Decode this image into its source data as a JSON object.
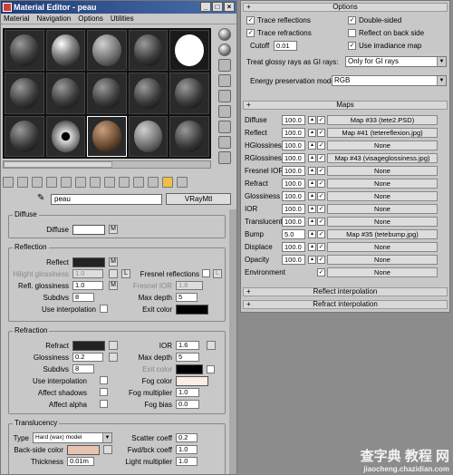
{
  "window": {
    "title": "Material Editor - peau",
    "buttons": [
      "_",
      "□",
      "×"
    ]
  },
  "menu": [
    "Material",
    "Navigation",
    "Options",
    "Utilities"
  ],
  "material": {
    "name": "peau",
    "type": "VRayMtl"
  },
  "diffuse": {
    "title": "Diffuse",
    "label": "Diffuse",
    "m": "M"
  },
  "reflection": {
    "title": "Reflection",
    "reflect": "Reflect",
    "m": "M",
    "hilight_label": "Hilight glossiness",
    "hilight_val": "1.0",
    "l": "L",
    "fresnel_label": "Fresnel reflections",
    "l2": "L",
    "refl_gloss_label": "Refl. glossiness",
    "refl_gloss_val": "1.0",
    "fresnel_ior_label": "Fresnel IOR",
    "fresnel_ior_val": "1.6",
    "subdivs_label": "Subdivs",
    "subdivs_val": "8",
    "maxdepth_label": "Max depth",
    "maxdepth_val": "5",
    "interp_label": "Use interpolation",
    "exit_label": "Exit color"
  },
  "refraction": {
    "title": "Refraction",
    "refract": "Refract",
    "ior_label": "IOR",
    "ior_val": "1.6",
    "gloss_label": "Glossiness",
    "gloss_val": "0.2",
    "maxdepth_label": "Max depth",
    "maxdepth_val": "5",
    "subdivs_label": "Subdivs",
    "subdivs_val": "8",
    "exit_label": "Exit color",
    "interp_label": "Use interpolation",
    "fog_color_label": "Fog color",
    "shadows_label": "Affect shadows",
    "fog_mult_label": "Fog multiplier",
    "fog_mult_val": "1.0",
    "alpha_label": "Affect alpha",
    "fog_bias_label": "Fog bias",
    "fog_bias_val": "0.0"
  },
  "translucency": {
    "title": "Translucency",
    "type_label": "Type",
    "type_val": "Hard (wax) model",
    "scatter_label": "Scatter coeff",
    "scatter_val": "0.2",
    "back_label": "Back-side color",
    "fwd_label": "Fwd/bck coeff",
    "fwd_val": "1.0",
    "thick_label": "Thickness",
    "thick_val": "0.01m",
    "light_label": "Light multiplier",
    "light_val": "1.0"
  },
  "options": {
    "title": "Options",
    "trace_refl": "Trace reflections",
    "double": "Double-sided",
    "trace_refr": "Trace refractions",
    "back": "Reflect on back side",
    "cutoff_label": "Cutoff",
    "cutoff_val": "0.01",
    "irr": "Use irradiance map",
    "glossy_label": "Treat glossy rays as GI rays:",
    "glossy_val": "Only for GI rays",
    "energy_label": "Energy preservation mode",
    "energy_val": "RGB"
  },
  "maps": {
    "title": "Maps",
    "rows": [
      {
        "name": "Diffuse",
        "val": "100.0",
        "map": "Map #33 (tete2.PSD)"
      },
      {
        "name": "Reflect",
        "val": "100.0",
        "map": "Map #41 (tetereflexion.jpg)"
      },
      {
        "name": "HGlossiness",
        "val": "100.0",
        "map": "None"
      },
      {
        "name": "RGlossiness",
        "val": "100.0",
        "map": "Map #43 (visageglossiness.jpg)"
      },
      {
        "name": "Fresnel IOR",
        "val": "100.0",
        "map": "None"
      },
      {
        "name": "Refract",
        "val": "100.0",
        "map": "None"
      },
      {
        "name": "Glossiness",
        "val": "100.0",
        "map": "None"
      },
      {
        "name": "IOR",
        "val": "100.0",
        "map": "None"
      },
      {
        "name": "Translucent",
        "val": "100.0",
        "map": "None"
      },
      {
        "name": "Bump",
        "val": "5.0",
        "map": "Map #35 (tetebump.jpg)"
      },
      {
        "name": "Displace",
        "val": "100.0",
        "map": "None"
      },
      {
        "name": "Opacity",
        "val": "100.0",
        "map": "None"
      },
      {
        "name": "Environment",
        "val": "",
        "map": "None"
      }
    ]
  },
  "rollouts": {
    "reflect_interp": "Reflect interpolation",
    "refract_interp": "Refract interpolation",
    "plus": "+"
  },
  "watermark": {
    "big": "查字典 教程 网",
    "small": "jiaocheng.chazidian.com"
  },
  "colors": {
    "diffuse": "#ffffff",
    "reflect": "#222222",
    "exit": "#000000",
    "refract": "#222222",
    "refr_exit": "#000000",
    "fog": "#fbeee4",
    "backside": "#e8c4b0"
  }
}
